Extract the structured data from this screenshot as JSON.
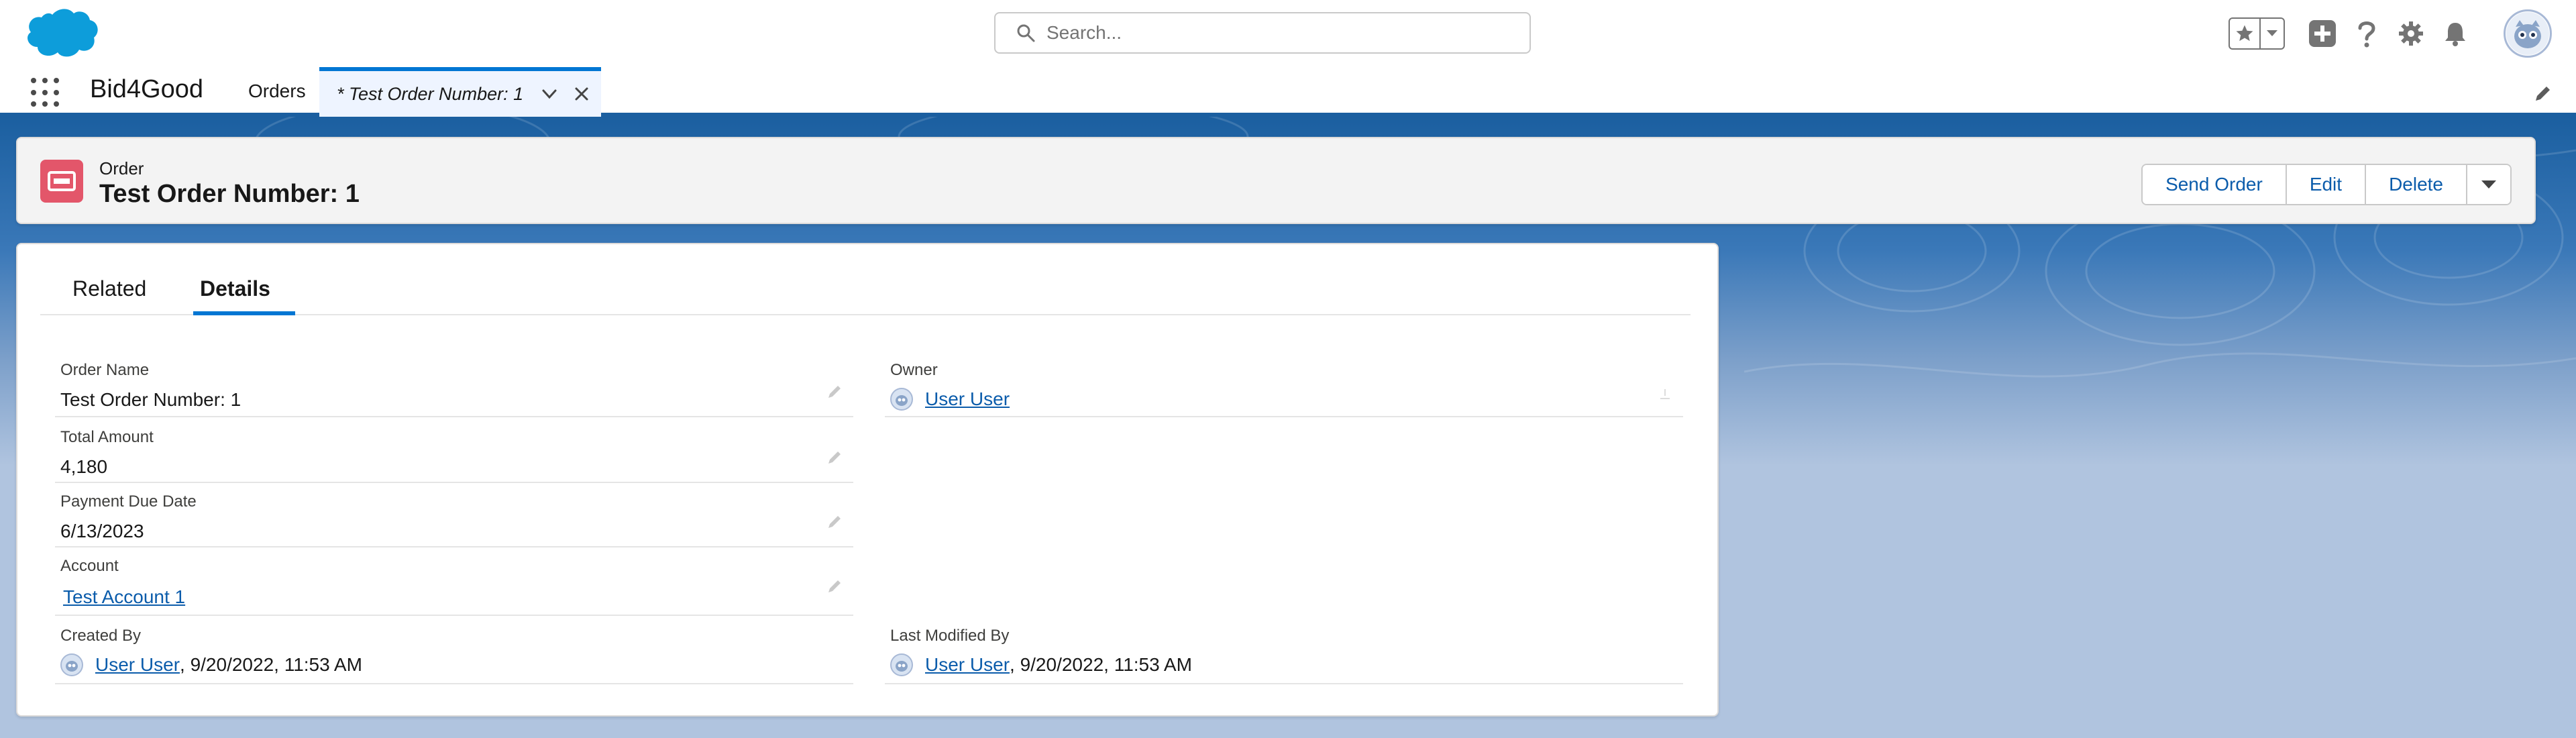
{
  "global_header": {
    "search_placeholder": "Search...",
    "icons": [
      "cloud-logo",
      "search-icon",
      "favorites-star-icon",
      "favorites-caret-icon",
      "global-actions-plus-icon",
      "help-icon",
      "setup-gear-icon",
      "notifications-bell-icon",
      "user-avatar"
    ]
  },
  "app_nav": {
    "app_name": "Bid4Good",
    "items": [
      {
        "label": "Orders"
      }
    ],
    "active_tab": {
      "label": "* Test Order Number: 1"
    }
  },
  "record": {
    "object_type": "Order",
    "title": "Test Order Number: 1",
    "actions": {
      "send_order": "Send Order",
      "edit": "Edit",
      "delete": "Delete"
    }
  },
  "tabs": {
    "related": "Related",
    "details": "Details",
    "selected": "Details"
  },
  "fields": {
    "order_name": {
      "label": "Order Name",
      "value": "Test Order Number: 1"
    },
    "owner": {
      "label": "Owner",
      "value": "User User"
    },
    "total_amount": {
      "label": "Total Amount",
      "value": "4,180"
    },
    "payment_due_date": {
      "label": "Payment Due Date",
      "value": "6/13/2023"
    },
    "account": {
      "label": "Account",
      "value": "Test Account 1"
    },
    "created_by": {
      "label": "Created By",
      "user": "User User",
      "timestamp": ", 9/20/2022, 11:53 AM"
    },
    "last_modified_by": {
      "label": "Last Modified By",
      "user": "User User",
      "timestamp": ", 9/20/2022, 11:53 AM"
    }
  },
  "colors": {
    "brand_blue": "#0176d3",
    "link_blue": "#0b5cab",
    "order_icon": "#e3566a",
    "nav_band": "#1b5fa0",
    "page_background": "#b0c4df"
  }
}
